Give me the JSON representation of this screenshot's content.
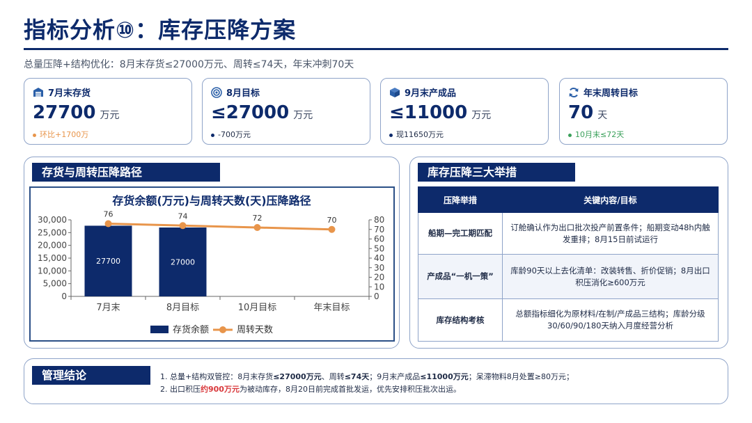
{
  "header": {
    "title": "指标分析⑩：库存压降方案",
    "subtitle": "总量压降+结构优化：8月末存货≤27000万元、周转≤74天，年末冲刺70天"
  },
  "kpis": [
    {
      "label": "7月末存货",
      "value": "27700",
      "unit": "万元",
      "note": "环比+1700万",
      "color": "#e8954b",
      "icon": "inventory-icon"
    },
    {
      "label": "8月目标",
      "value": "≤27000",
      "unit": "万元",
      "note": "-700万元",
      "color": "#0d2a6b",
      "icon": "target-icon"
    },
    {
      "label": "9月末产成品",
      "value": "≤11000",
      "unit": "万元",
      "note": "现11650万元",
      "color": "#0d2a6b",
      "icon": "box-icon"
    },
    {
      "label": "年末周转目标",
      "value": "70",
      "unit": "天",
      "note": "10月末≤72天",
      "color": "#3aa05a",
      "icon": "refresh-icon"
    }
  ],
  "left_panel": {
    "label": "存货与周转压降路径"
  },
  "chart_data": {
    "type": "bar",
    "title": "存货余额(万元)与周转天数(天)压降路径",
    "categories": [
      "7月末",
      "8月目标",
      "10月目标",
      "年末目标"
    ],
    "series": [
      {
        "name": "存货余额",
        "type": "bar",
        "axis": "left",
        "values": [
          27700,
          27000,
          null,
          null
        ],
        "labels": [
          "27700",
          "27000"
        ],
        "color": "#0d2a6b"
      },
      {
        "name": "周转天数",
        "type": "line",
        "axis": "right",
        "values": [
          76,
          74,
          72,
          70
        ],
        "color": "#e8954b"
      }
    ],
    "y_left": {
      "min": 0,
      "max": 30000,
      "ticks": [
        "0",
        "5,000",
        "10,000",
        "15,000",
        "20,000",
        "25,000",
        "30,000"
      ]
    },
    "y_right": {
      "min": 0,
      "max": 80,
      "ticks": [
        "0",
        "10",
        "20",
        "30",
        "40",
        "50",
        "60",
        "70",
        "80"
      ]
    },
    "legend": "bottom",
    "grid": false
  },
  "right_panel": {
    "label": "库存压降三大举措",
    "headers": [
      "压降举措",
      "关键内容/目标"
    ],
    "rows": [
      {
        "measure": "船期—完工期匹配",
        "content": "订舱确认作为出口批次投产前置条件；船期变动48h内触发重排；8月15日前试运行"
      },
      {
        "measure": "产成品“一机一策”",
        "content": "库龄90天以上去化清单：改装转售、折价促销；8月出口积压消化≥600万元"
      },
      {
        "measure": "库存结构考核",
        "content": "总额指标细化为原材料/在制/产成品三结构；库龄分级30/60/90/180天纳入月度经营分析"
      }
    ]
  },
  "conclusion": {
    "label": "管理结论",
    "l1_a": "1. 总量+结构双管控：8月末存货",
    "l1_b": "≤27000万元",
    "l1_c": "、周转",
    "l1_d": "≤74天",
    "l1_e": "；9月末产成品",
    "l1_f": "≤11000万元",
    "l1_g": "；呆滞物料8月处置≥80万元；",
    "l2_a": "2. 出口积压",
    "l2_b": "约900万元",
    "l2_c": "为被动库存，8月20日前完成首批发运，优先安排积压批次出运。"
  },
  "theme": {
    "navy": "#0d2a6b",
    "orange": "#e8954b",
    "border": "#8ea3c8"
  }
}
